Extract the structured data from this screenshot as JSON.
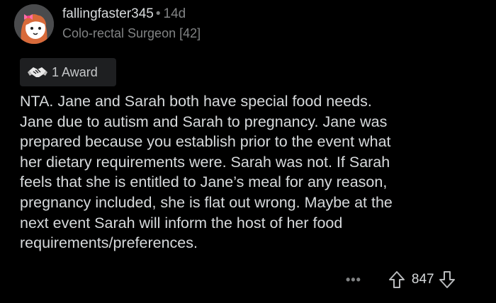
{
  "comment": {
    "author": "fallingfaster345",
    "separator": "•",
    "age": "14d",
    "flair": "Colo-rectal Surgeon [42]",
    "award_label": "1 Award",
    "body_lines": [
      "NTA. Jane and Sarah both have special food needs.",
      "Jane due to autism and Sarah to pregnancy. Jane was",
      "prepared because you establish prior to the event what",
      "her dietary requirements were. Sarah was not. If Sarah",
      "feels that she is entitled to Jane’s meal for any reason,",
      "pregnancy included, she is flat out wrong. Maybe at the",
      "next event Sarah will inform the host of her food",
      "requirements/preferences."
    ],
    "more_label": "•••",
    "score": "847"
  },
  "icons": {
    "avatar": "avatar-icon",
    "award": "award-icon",
    "upvote": "upvote-arrow-icon",
    "downvote": "downvote-arrow-icon"
  },
  "colors": {
    "background": "#000000",
    "text": "#d7dadc",
    "muted": "#818384",
    "award_bg": "#1e1f21",
    "avatar_hair": "#d86a3a"
  }
}
